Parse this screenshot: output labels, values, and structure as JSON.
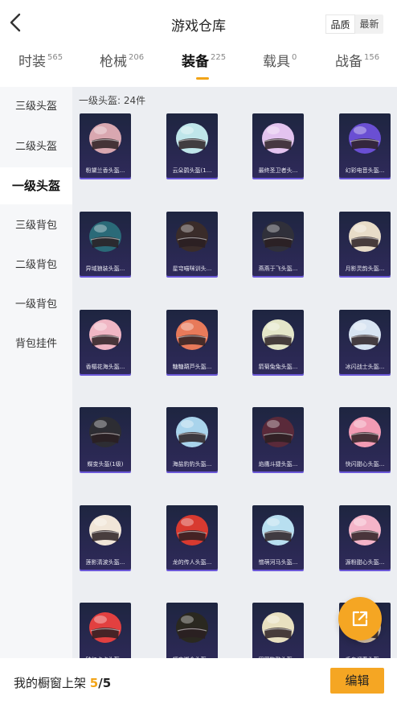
{
  "header": {
    "title": "游戏仓库",
    "sort_options": [
      "品质",
      "最新"
    ],
    "sort_active": 0
  },
  "tabs": [
    {
      "label": "时装",
      "count": "565"
    },
    {
      "label": "枪械",
      "count": "206"
    },
    {
      "label": "装备",
      "count": "225"
    },
    {
      "label": "载具",
      "count": "0"
    },
    {
      "label": "战备",
      "count": "156"
    }
  ],
  "active_tab": 2,
  "sidebar": {
    "items": [
      {
        "label": "三级头盔"
      },
      {
        "label": "二级头盔"
      },
      {
        "label": "一级头盔"
      },
      {
        "label": "三级背包"
      },
      {
        "label": "二级背包"
      },
      {
        "label": "一级背包"
      },
      {
        "label": "背包挂件"
      }
    ],
    "active": 2
  },
  "section": {
    "title": "一级头盔: 24件"
  },
  "items": [
    {
      "name": "粉黛兰香头盔...",
      "color": "#d9a7b0"
    },
    {
      "name": "云朵鹞头盔(1...",
      "color": "#bfe6ea"
    },
    {
      "name": "最终圣卫者头...",
      "color": "#e3c3ef"
    },
    {
      "name": "幻彩电音头盔...",
      "color": "#6a4fd3"
    },
    {
      "name": "异域狼装头盔...",
      "color": "#2a6a78"
    },
    {
      "name": "星穹喵咪训头...",
      "color": "#3a2c2a"
    },
    {
      "name": "燕燕于飞头盔...",
      "color": "#30303a"
    },
    {
      "name": "月影灵韵头盔...",
      "color": "#e8dcc8"
    },
    {
      "name": "香榻花海头盔...",
      "color": "#f0b6c4"
    },
    {
      "name": "糖糖葫芦头盔...",
      "color": "#e87a5a"
    },
    {
      "name": "箭菊兔兔头盔...",
      "color": "#e4e6c8"
    },
    {
      "name": "冰闪战士头盔...",
      "color": "#d8e4f2"
    },
    {
      "name": "蝶变头盔(1级)",
      "color": "#2d2d33"
    },
    {
      "name": "海盐豹豹头盔...",
      "color": "#a9d4ec"
    },
    {
      "name": "焰鹰斗捷头盔...",
      "color": "#5a2a3a"
    },
    {
      "name": "快闪甜心头盔...",
      "color": "#f29bb4"
    },
    {
      "name": "莲影清波头盔...",
      "color": "#f1e6d8"
    },
    {
      "name": "龙的传人头盔...",
      "color": "#d83a30"
    },
    {
      "name": "憎萌河马头盔...",
      "color": "#b8dff0"
    },
    {
      "name": "源粉甜心头盔...",
      "color": "#f4b4c8"
    },
    {
      "name": "钟红点点头盔...",
      "color": "#e24040"
    },
    {
      "name": "蝠夜迦金头盔...",
      "color": "#2a2820"
    },
    {
      "name": "田园牧歌头盔...",
      "color": "#e8e0c0"
    },
    {
      "name": "千鸟迎春头盔...",
      "color": "#d8c4a8"
    }
  ],
  "footer": {
    "label": "我的橱窗上架",
    "current": "5",
    "sep_total": "/5",
    "edit_label": "编辑"
  },
  "accent": "#f5a623"
}
